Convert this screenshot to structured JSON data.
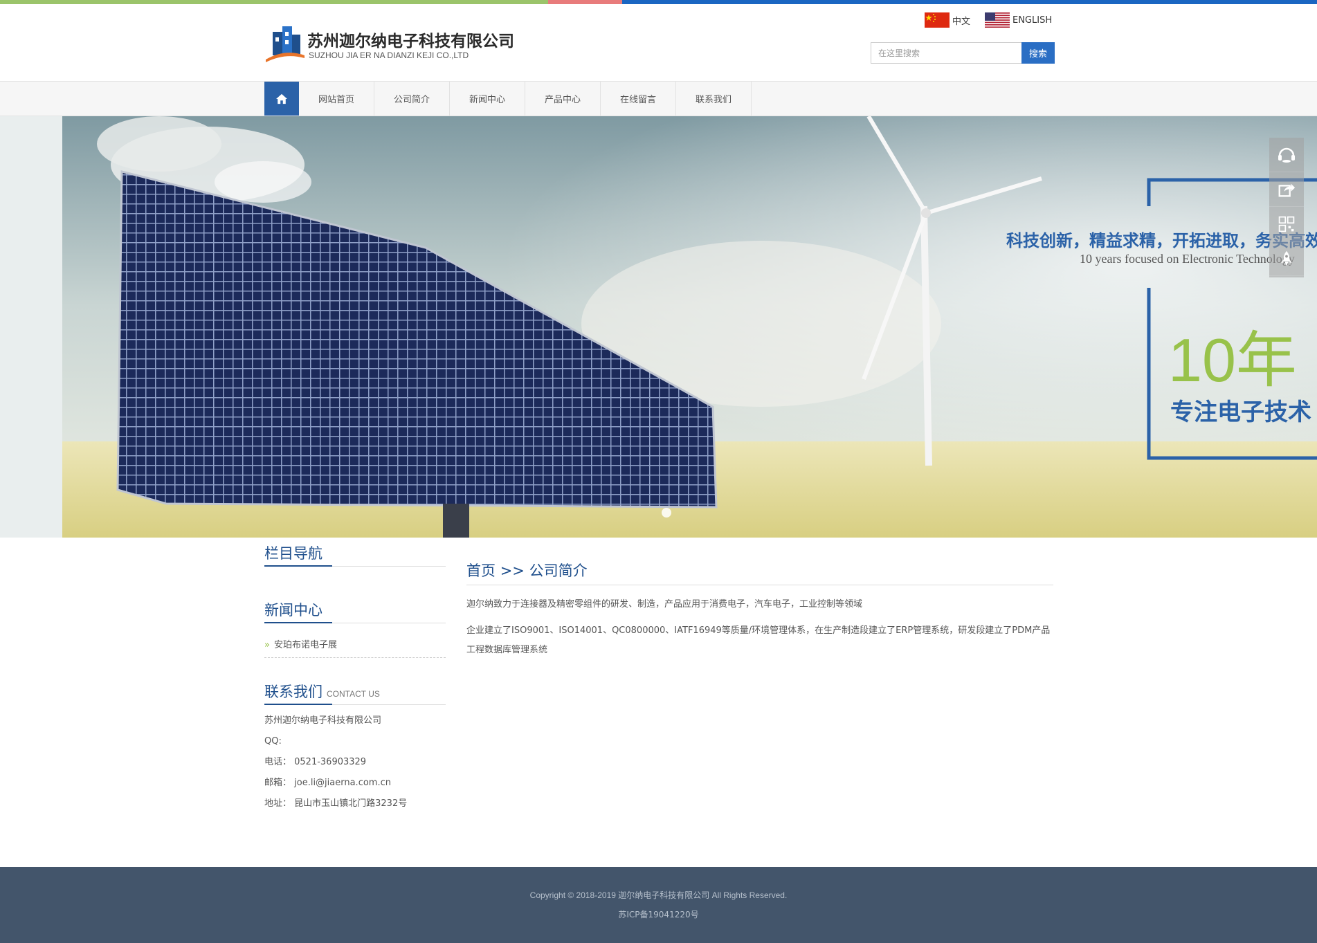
{
  "brand": {
    "name_cn": "苏州迦尔纳电子科技有限公司",
    "name_en": "SUZHOU JIA ER NA DIANZI KEJI CO.,LTD"
  },
  "languages": [
    {
      "label": "中文",
      "icon": "china-flag-icon"
    },
    {
      "label": "ENGLISH",
      "icon": "us-flag-icon"
    }
  ],
  "search": {
    "placeholder": "在这里搜索",
    "button_label": "搜索"
  },
  "nav": {
    "home_icon": "home-icon",
    "items": [
      {
        "label": "网站首页"
      },
      {
        "label": "公司简介"
      },
      {
        "label": "新闻中心"
      },
      {
        "label": "产品中心"
      },
      {
        "label": "在线留言"
      },
      {
        "label": "联系我们"
      }
    ]
  },
  "banner": {
    "slogan_cn": "科技创新，精益求精，开拓进取，务实高效",
    "slogan_en": "10 years focused on Electronic Technology",
    "years": "10年",
    "years_sub": "专注电子技术",
    "colors": {
      "blue": "#2b62a8",
      "green": "#98c24a"
    }
  },
  "side_tools": [
    {
      "icon": "customer-service-icon"
    },
    {
      "icon": "share-icon"
    },
    {
      "icon": "qrcode-icon"
    },
    {
      "icon": "rocket-top-icon"
    }
  ],
  "sidebar": {
    "nav_title": "栏目导航",
    "news_title": "新闻中心",
    "news_items": [
      {
        "label": "安珀布诺电子展"
      }
    ],
    "contact_title": "联系我们",
    "contact_title_en": "CONTACT US",
    "contact": {
      "company": "苏州迦尔纳电子科技有限公司",
      "qq": "QQ:",
      "phone": "电话：  0521-36903329",
      "email": "邮箱：  joe.li@jiaerna.com.cn",
      "address": "地址：  昆山市玉山镇北门路3232号"
    }
  },
  "content": {
    "crumb_home": "首页",
    "crumb_sep": ">>",
    "crumb_current": "公司简介",
    "paragraphs": [
      "迦尔纳致力于连接器及精密零组件的研发、制造，产品应用于消费电子，汽车电子，工业控制等领域",
      "企业建立了ISO9001、ISO14001、QC0800000、IATF16949等质量/环境管理体系，在生产制造段建立了ERP管理系统，研发段建立了PDM产品工程数据库管理系统"
    ]
  },
  "footer": {
    "copyright": "Copyright © 2018-2019 迦尔纳电子科技有限公司 All Rights Reserved.",
    "icp": "苏ICP备19041220号"
  },
  "colors": {
    "primary": "#2b62a8",
    "footer_bg": "#43556b"
  }
}
